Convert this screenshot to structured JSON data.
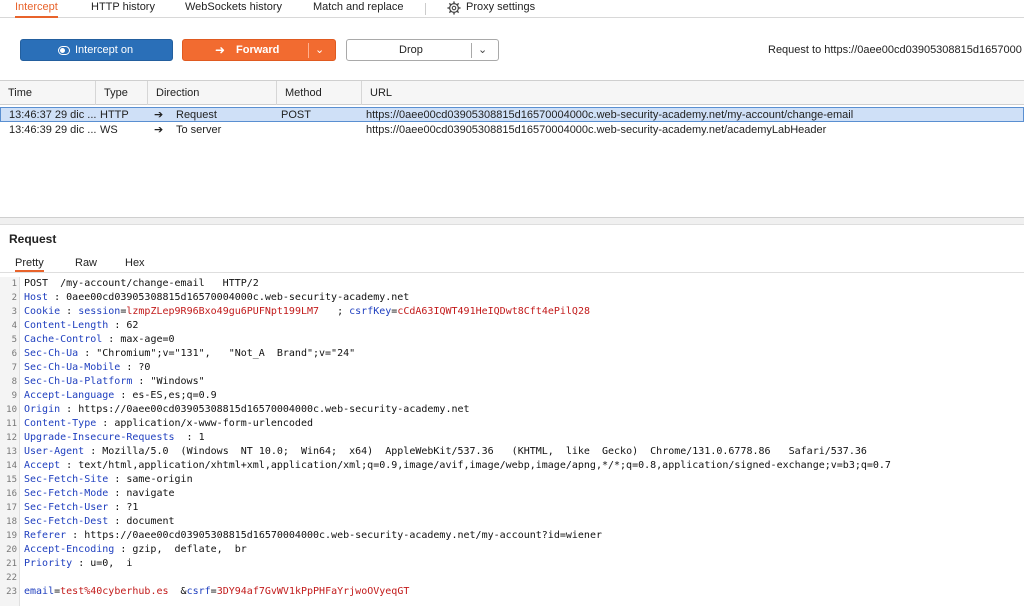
{
  "tabs": [
    {
      "label": "Intercept",
      "active": true
    },
    {
      "label": "HTTP history",
      "active": false
    },
    {
      "label": "WebSockets history",
      "active": false
    },
    {
      "label": "Match and replace",
      "active": false
    },
    {
      "label": "Proxy settings",
      "active": false
    }
  ],
  "toolbar": {
    "intercept_label": "Intercept on",
    "forward_label": "Forward",
    "drop_label": "Drop",
    "request_to": "Request to https://0aee00cd03905308815d1657000"
  },
  "table": {
    "columns": [
      "Time",
      "Type",
      "Direction",
      "Method",
      "URL"
    ],
    "rows": [
      {
        "time": "13:46:37 29 dic ...",
        "type": "HTTP",
        "direction": "Request",
        "method": "POST",
        "url": "https://0aee00cd03905308815d16570004000c.web-security-academy.net/my-account/change-email",
        "selected": true
      },
      {
        "time": "13:46:39 29 dic ...",
        "type": "WS",
        "direction": "To server",
        "method": "",
        "url": "https://0aee00cd03905308815d16570004000c.web-security-academy.net/academyLabHeader",
        "selected": false
      }
    ]
  },
  "request": {
    "title": "Request",
    "tabs": [
      "Pretty",
      "Raw",
      "Hex"
    ],
    "request_line": "POST  /my-account/change-email   HTTP/2",
    "headers": [
      {
        "name": "Host",
        "value": "0aee00cd03905308815d16570004000c.web-security-academy.net"
      },
      {
        "name": "Cookie",
        "value": ""
      },
      {
        "name": "Content-Length",
        "value": "62"
      },
      {
        "name": "Cache-Control",
        "value": "max-age=0"
      },
      {
        "name": "Sec-Ch-Ua",
        "value": "\"Chromium\";v=\"131\",   \"Not_A  Brand\";v=\"24\""
      },
      {
        "name": "Sec-Ch-Ua-Mobile",
        "value": "?0"
      },
      {
        "name": "Sec-Ch-Ua-Platform",
        "value": "\"Windows\""
      },
      {
        "name": "Accept-Language",
        "value": "es-ES,es;q=0.9"
      },
      {
        "name": "Origin",
        "value": "https://0aee00cd03905308815d16570004000c.web-security-academy.net"
      },
      {
        "name": "Content-Type",
        "value": "application/x-www-form-urlencoded"
      },
      {
        "name": "Upgrade-Insecure-Requests",
        "value": "1"
      },
      {
        "name": "User-Agent",
        "value": "Mozilla/5.0  (Windows  NT 10.0;  Win64;  x64)  AppleWebKit/537.36   (KHTML,  like  Gecko)  Chrome/131.0.6778.86   Safari/537.36"
      },
      {
        "name": "Accept",
        "value": "text/html,application/xhtml+xml,application/xml;q=0.9,image/avif,image/webp,image/apng,*/*;q=0.8,application/signed-exchange;v=b3;q=0.7"
      },
      {
        "name": "Sec-Fetch-Site",
        "value": "same-origin"
      },
      {
        "name": "Sec-Fetch-Mode",
        "value": "navigate"
      },
      {
        "name": "Sec-Fetch-User",
        "value": "?1"
      },
      {
        "name": "Sec-Fetch-Dest",
        "value": "document"
      },
      {
        "name": "Referer",
        "value": "https://0aee00cd03905308815d16570004000c.web-security-academy.net/my-account?id=wiener"
      },
      {
        "name": "Accept-Encoding",
        "value": "gzip,  deflate,  br"
      },
      {
        "name": "Priority",
        "value": "u=0,  i"
      }
    ],
    "cookies": {
      "session_key": "session",
      "session_value": "lzmpZLep9R96Bxo49gu6PUFNpt199LM7",
      "csrf_key": "csrfKey",
      "csrf_value": "cCdA63IQWT491HeIQDwt8Cft4ePilQ28"
    },
    "body": {
      "email_key": "email",
      "email_value": "test%40cyberhub.es",
      "csrf_key": "csrf",
      "csrf_value": "3DY94af7GvWV1kPpPHFaYrjwoOVyeqGT"
    },
    "line_numbers": [
      "1",
      "2",
      "3",
      "4",
      "5",
      "6",
      "7",
      "8",
      "9",
      "10",
      "11",
      "12",
      "13",
      "14",
      "15",
      "16",
      "17",
      "18",
      "19",
      "20",
      "21",
      "22",
      "23"
    ]
  }
}
